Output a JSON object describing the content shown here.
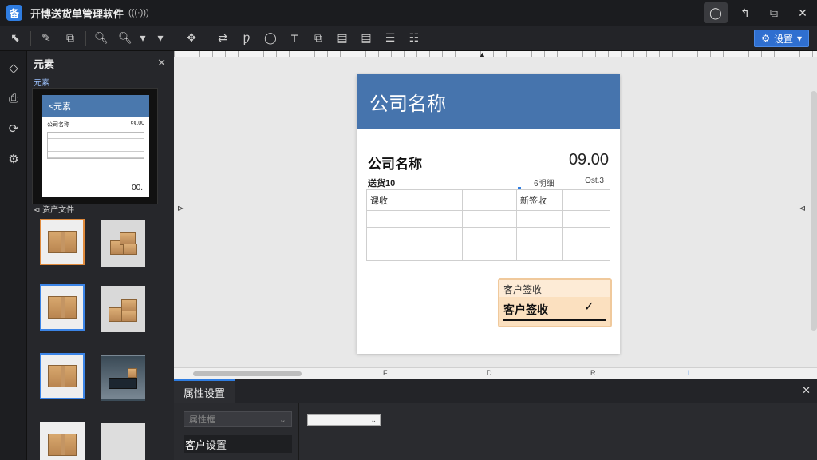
{
  "app": {
    "logo": "备",
    "title": "开博送货单管理软件",
    "subtitle": "(((·)))"
  },
  "window_controls": {
    "record": "◯",
    "back": "↰",
    "popout": "⧉",
    "close": "✕"
  },
  "toolbar": {
    "left_tools": [
      "⬉",
      "✎",
      "⧉",
      "🔍︎",
      "🔍︎",
      "▾",
      "▾"
    ],
    "right_tools": [
      "✥",
      "⇄",
      "Ƿ",
      "◯",
      "T",
      "⧉",
      "▤",
      "▤",
      "☰",
      "☷"
    ],
    "settings_icon": "⚙",
    "settings_label": "设置",
    "settings_arrow": "▾"
  },
  "rail": {
    "icons": [
      "◇",
      "⎙",
      "⟳",
      "⚙"
    ]
  },
  "elements_panel": {
    "title": "元素",
    "close": "✕",
    "tab": "元素",
    "preview": {
      "header": "≤元素",
      "row1_left": "公司名称",
      "row1_right": "¢¢.00",
      "total": "00.",
      "assets_label": "⊲ 资产文件"
    }
  },
  "document": {
    "header_title": "公司名称",
    "company_name": "公司名称",
    "amount": "09.00",
    "label_left": "送货10",
    "label_mid": "6明细",
    "label_right": "Ost.3",
    "table_header": [
      "课收",
      "",
      "新签收",
      ""
    ],
    "table_rows": [
      [
        "",
        "",
        "",
        ""
      ],
      [
        "",
        "",
        "",
        ""
      ],
      [
        "",
        "",
        "",
        ""
      ]
    ],
    "sign_top": "客户签收",
    "sign_label": "客户签收",
    "sign_mark": "✓"
  },
  "canvas": {
    "top_marker": "▲",
    "left_handle": "⊳",
    "right_handle": "⊲",
    "bottom_marks": [
      "F",
      "D",
      "R",
      "L"
    ]
  },
  "property_panel": {
    "tab": "属性设置",
    "minimize": "—",
    "close": "✕",
    "select_placeholder": "属性框",
    "select_arrow": "⌄",
    "item": "客户设置",
    "dropdown_arrow": "⌄"
  }
}
